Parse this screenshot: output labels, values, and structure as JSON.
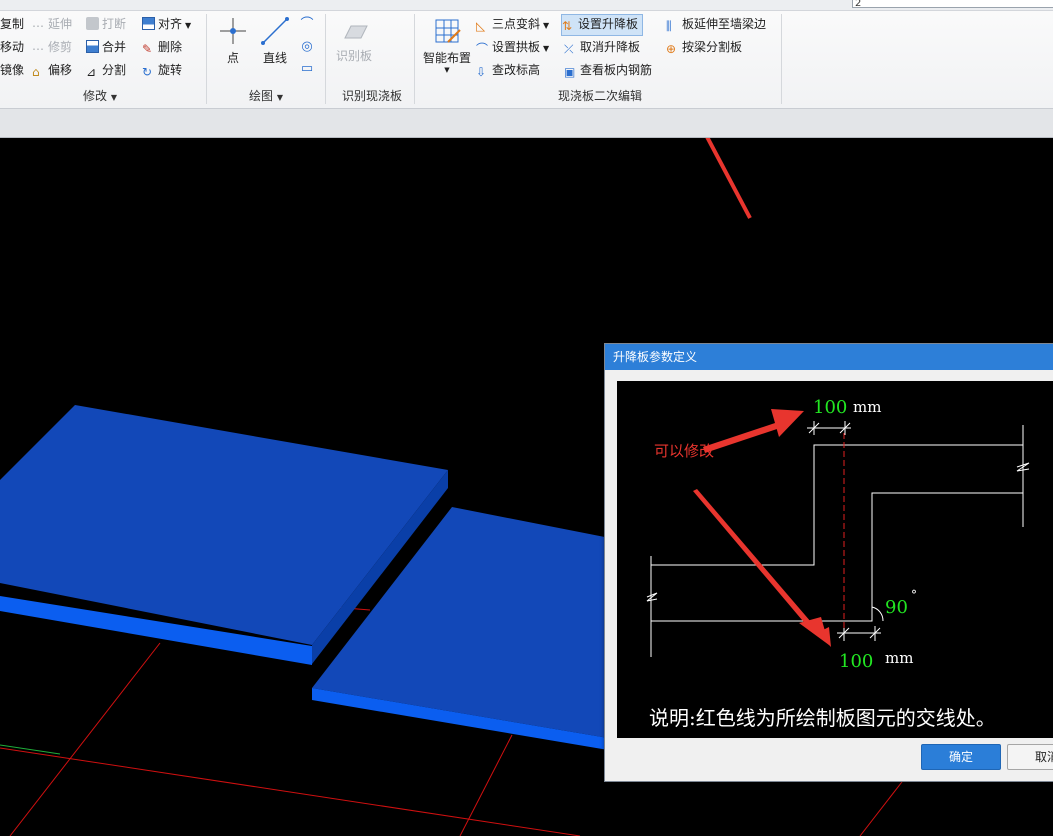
{
  "ribbon": {
    "top_input_value": "2",
    "modify": {
      "copy": "复制",
      "extend": "延伸",
      "break": "打断",
      "align": "对齐",
      "move": "移动",
      "trim": "修剪",
      "merge": "合并",
      "delete": "删除",
      "mirror": "镜像",
      "offset": "偏移",
      "split": "分割",
      "rotate": "旋转",
      "group_label": "修改"
    },
    "draw": {
      "point": "点",
      "line": "直线",
      "group_label": "绘图"
    },
    "identify": {
      "identify_slab": "识别板",
      "group_label": "识别现浇板"
    },
    "edit": {
      "smart_layout": "智能布置",
      "three_point_slope": "三点变斜",
      "set_raised_slab": "设置升降板",
      "extend_slab": "板延伸至墙梁边",
      "set_arch_slab": "设置拱板",
      "cancel_raised_slab": "取消升降板",
      "split_by_beam": "按梁分割板",
      "change_elevation": "查改标高",
      "view_rebar": "查看板内钢筋",
      "group_label": "现浇板二次编辑"
    }
  },
  "dialog": {
    "title": "升降板参数定义",
    "top_value": "100",
    "top_unit": "mm",
    "angle_value": "90",
    "angle_unit": "°",
    "bottom_value": "100",
    "bottom_unit": "mm",
    "annotation": "可以修改",
    "note": "说明:红色线为所绘制板图元的交线处。",
    "ok_label": "确定",
    "cancel_label": "取消"
  },
  "colors": {
    "slab_top": "#1248b8",
    "slab_side": "#0b5ef0",
    "grid_line": "#d01010",
    "value_green": "#22e622",
    "arrow_red": "#e8352e",
    "dialog_title": "#2d7fd8"
  }
}
